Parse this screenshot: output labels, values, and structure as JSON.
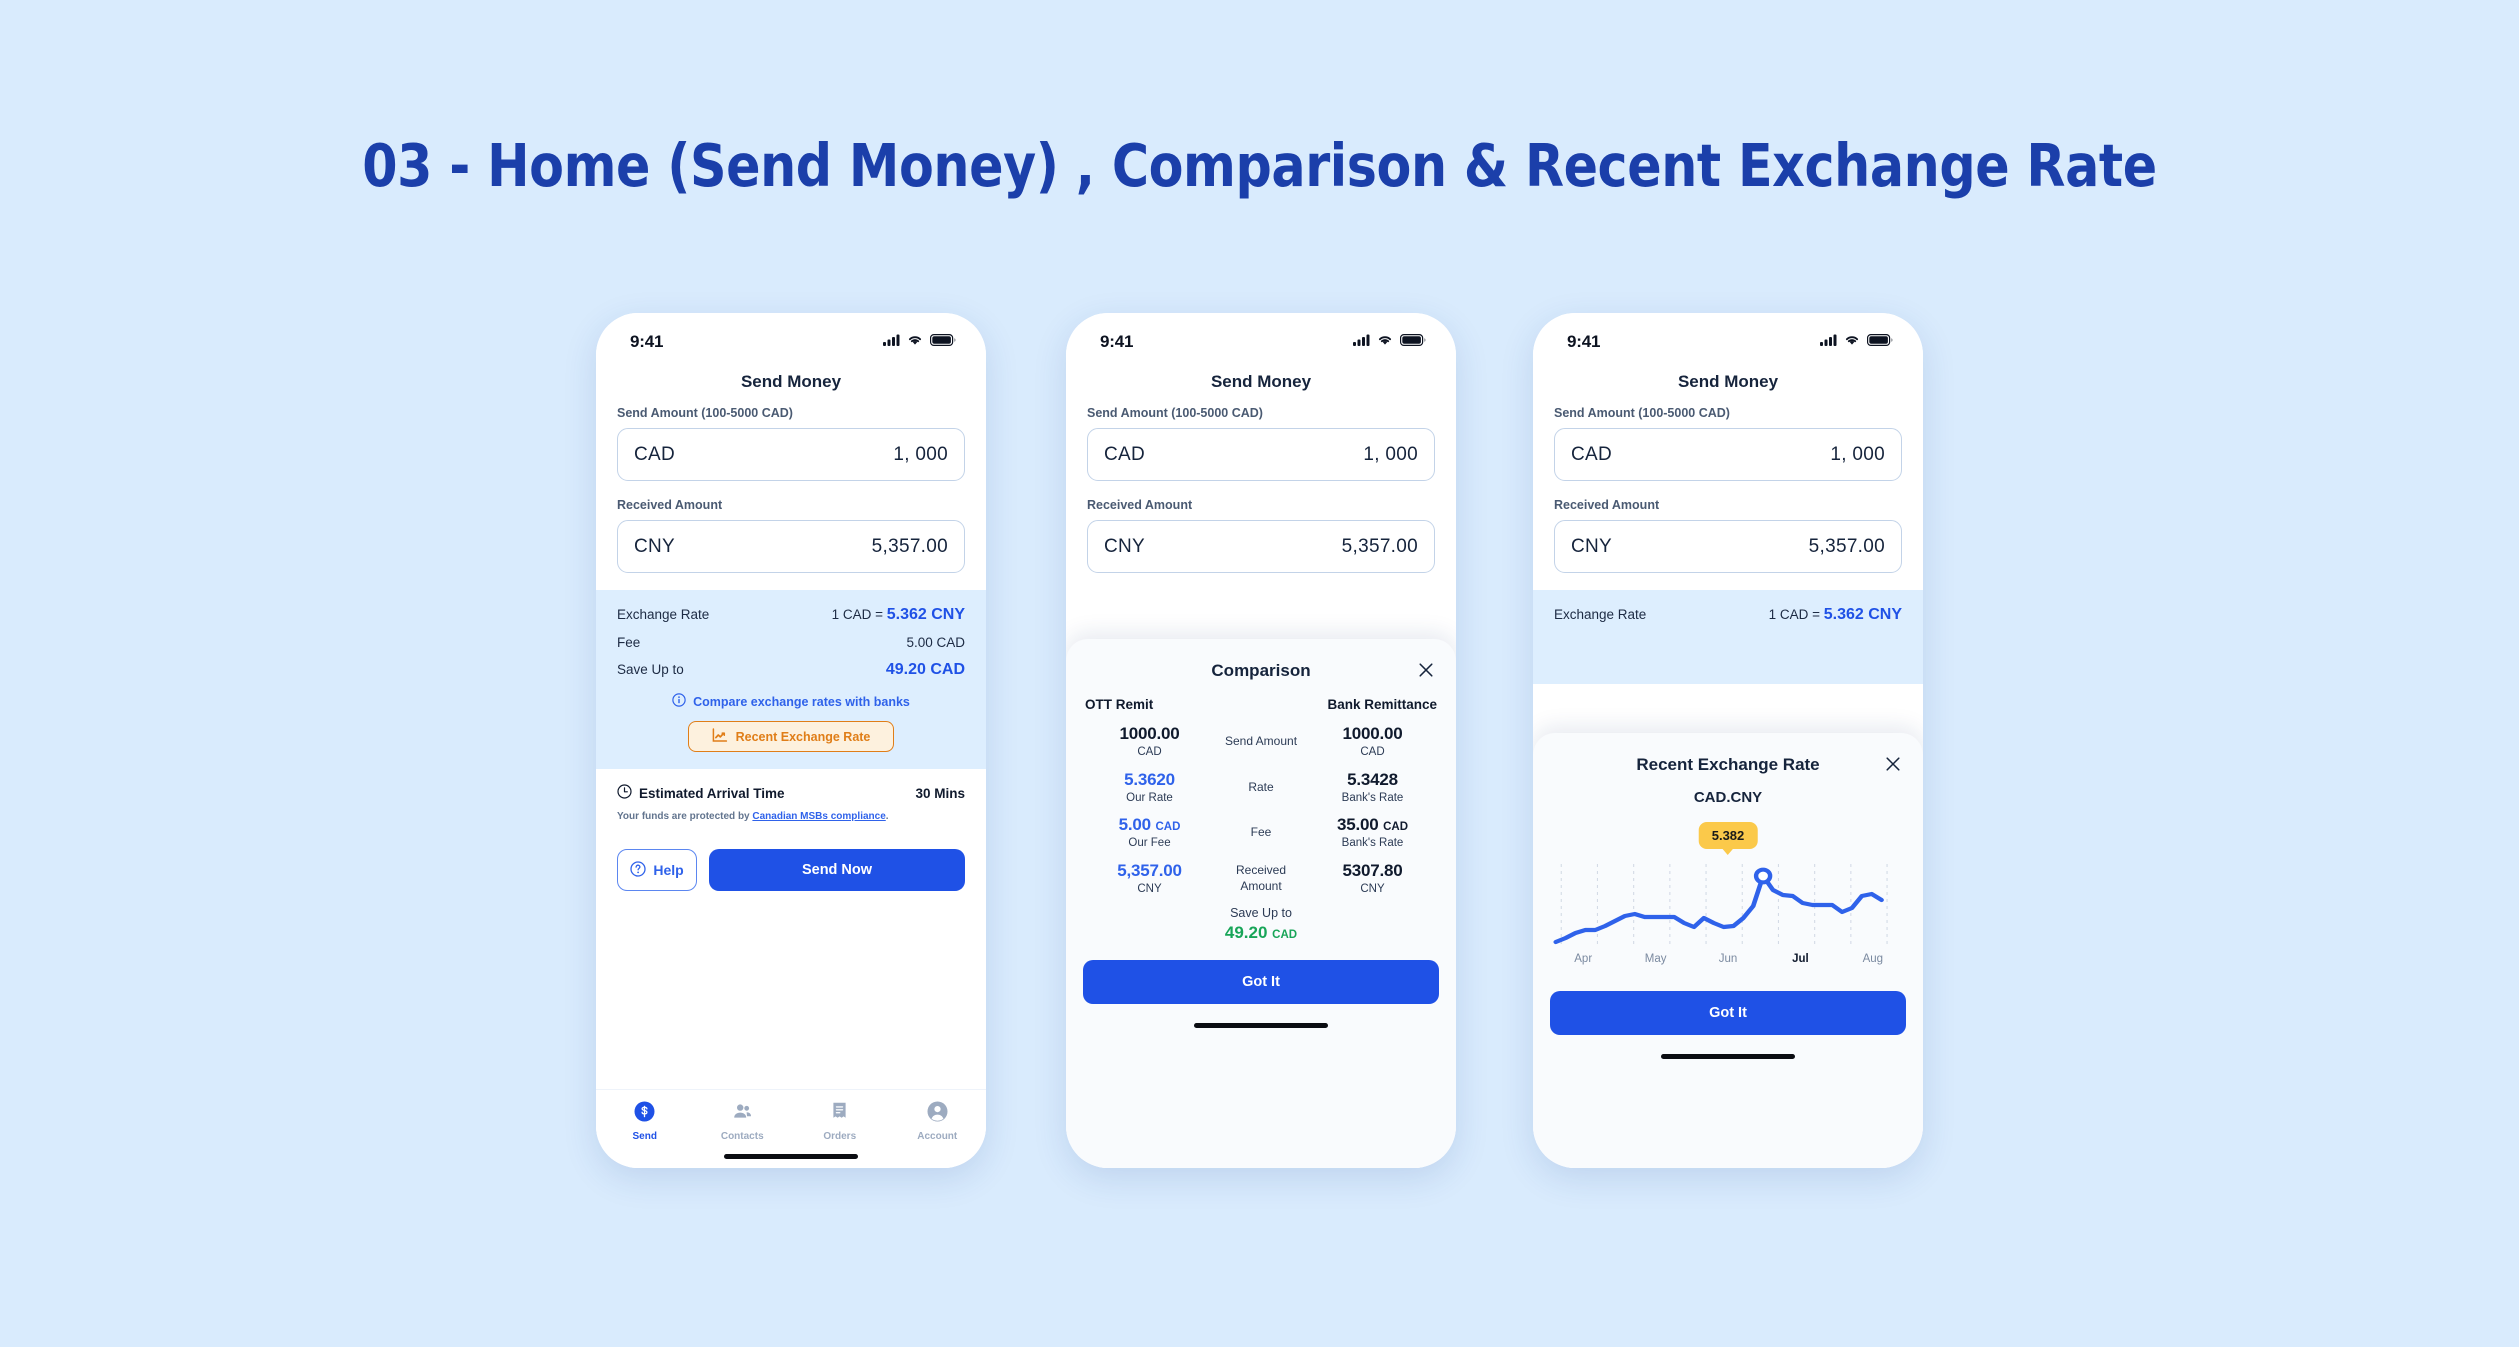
{
  "page": {
    "title": "03 - Home (Send Money) , Comparison & Recent Exchange Rate",
    "background_color": "#d9ebfd",
    "accent_blue": "#1f51e6",
    "accent_orange": "#e07e18",
    "accent_green": "#18a558",
    "tooltip_yellow": "#fbc94a"
  },
  "status_bar": {
    "time": "9:41",
    "cellular_icon": "cellular-signal-icon",
    "wifi_icon": "wifi-icon",
    "battery_icon": "battery-icon"
  },
  "send_money": {
    "screen_title": "Send Money",
    "send_amount_label": "Send Amount (100-5000 CAD)",
    "send_currency": "CAD",
    "send_value": "1, 000",
    "received_amount_label": "Received Amount",
    "received_currency": "CNY",
    "received_value": "5,357.00",
    "rate_label": "Exchange Rate",
    "rate_prefix": "1 CAD = ",
    "rate_value": "5.362 CNY",
    "fee_label": "Fee",
    "fee_value": "5.00 CAD",
    "save_label": "Save Up to",
    "save_value": "49.20 CAD",
    "compare_link": "Compare exchange rates with banks",
    "compare_icon": "info-circle-icon",
    "recent_rate_button": "Recent Exchange Rate",
    "recent_rate_icon": "line-chart-icon",
    "arrival_label": "Estimated Arrival Time",
    "arrival_icon": "clock-icon",
    "arrival_value": "30 Mins",
    "protect_prefix": "Your funds are protected by ",
    "protect_link": "Canadian MSBs compliance",
    "protect_suffix": ".",
    "help_button": "Help",
    "help_icon": "question-circle-icon",
    "send_now_button": "Send Now"
  },
  "tabbar": {
    "items": [
      {
        "label": "Send",
        "icon": "dollar-circle-icon",
        "active": true
      },
      {
        "label": "Contacts",
        "icon": "contacts-icon",
        "active": false
      },
      {
        "label": "Orders",
        "icon": "orders-receipt-icon",
        "active": false
      },
      {
        "label": "Account",
        "icon": "account-person-icon",
        "active": false
      }
    ]
  },
  "comparison": {
    "title": "Comparison",
    "close_icon": "close-icon",
    "col_left_header": "OTT Remit",
    "col_right_header": "Bank Remittance",
    "rows": [
      {
        "middle": "Send Amount",
        "left_value": "1000.00",
        "left_unit_inline": "",
        "left_sub": "CAD",
        "left_blue": false,
        "right_value": "1000.00",
        "right_unit_inline": "",
        "right_sub": "CAD"
      },
      {
        "middle": "Rate",
        "left_value": "5.3620",
        "left_unit_inline": "",
        "left_sub": "Our Rate",
        "left_blue": true,
        "right_value": "5.3428",
        "right_unit_inline": "",
        "right_sub": "Bank's Rate"
      },
      {
        "middle": "Fee",
        "left_value": "5.00",
        "left_unit_inline": "CAD",
        "left_sub": "Our Fee",
        "left_blue": true,
        "right_value": "35.00",
        "right_unit_inline": "CAD",
        "right_sub": "Bank's Rate"
      },
      {
        "middle": "Received Amount",
        "left_value": "5,357.00",
        "left_unit_inline": "",
        "left_sub": "CNY",
        "left_blue": true,
        "right_value": "5307.80",
        "right_unit_inline": "",
        "right_sub": "CNY"
      }
    ],
    "save_label": "Save Up to",
    "save_amount": "49.20",
    "save_unit": "CAD",
    "got_it_button": "Got It"
  },
  "recent_exchange_rate": {
    "title": "Recent Exchange Rate",
    "close_icon": "close-icon",
    "pair": "CAD.CNY",
    "tooltip_value": "5.382",
    "got_it_button": "Got It"
  },
  "chart_data": {
    "type": "line",
    "title": "Recent Exchange Rate",
    "subtitle": "CAD.CNY",
    "xlabel": "",
    "ylabel": "",
    "grid": true,
    "legend": null,
    "categories": [
      "Apr",
      "May",
      "Jun",
      "Jul",
      "Aug"
    ],
    "active_category": "Jul",
    "highlight_point": {
      "x": 21,
      "value": 5.382,
      "label": "5.382"
    },
    "ylim": [
      5.18,
      5.4
    ],
    "series": [
      {
        "name": "CAD.CNY",
        "color": "#2f62ea",
        "x": [
          0,
          1,
          2,
          3,
          4,
          5,
          6,
          7,
          8,
          9,
          10,
          11,
          12,
          13,
          14,
          15,
          16,
          17,
          18,
          19,
          20,
          21,
          22,
          23,
          24,
          25,
          26,
          27,
          28,
          29,
          30,
          31,
          32,
          33
        ],
        "values": [
          5.188,
          5.203,
          5.221,
          5.232,
          5.233,
          5.246,
          5.262,
          5.279,
          5.287,
          5.277,
          5.276,
          5.276,
          5.276,
          5.258,
          5.243,
          5.272,
          5.255,
          5.243,
          5.247,
          5.271,
          5.312,
          5.382,
          5.338,
          5.322,
          5.318,
          5.296,
          5.29,
          5.29,
          5.29,
          5.268,
          5.281,
          5.318,
          5.324,
          5.305
        ]
      }
    ]
  }
}
